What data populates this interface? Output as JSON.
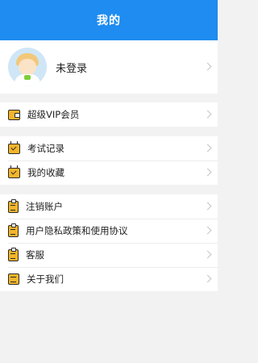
{
  "header": {
    "title": "我的"
  },
  "profile": {
    "name": "未登录",
    "avatar_icon": "user-avatar"
  },
  "groups": [
    {
      "items": [
        {
          "label": "超级VIP会员",
          "icon": "wallet-icon"
        }
      ]
    },
    {
      "items": [
        {
          "label": "考试记录",
          "icon": "calendar-check-icon"
        },
        {
          "label": "我的收藏",
          "icon": "calendar-check-icon"
        }
      ]
    },
    {
      "items": [
        {
          "label": "注销账户",
          "icon": "clipboard-icon"
        },
        {
          "label": "用户隐私政策和使用协议",
          "icon": "clipboard-icon"
        },
        {
          "label": "客服",
          "icon": "clipboard-icon"
        },
        {
          "label": "关于我们",
          "icon": "notes-icon"
        }
      ]
    }
  ],
  "colors": {
    "header_bg": "#1e8cf0",
    "icon_fill": "#f4b52b",
    "page_bg": "#f2f2f2"
  }
}
